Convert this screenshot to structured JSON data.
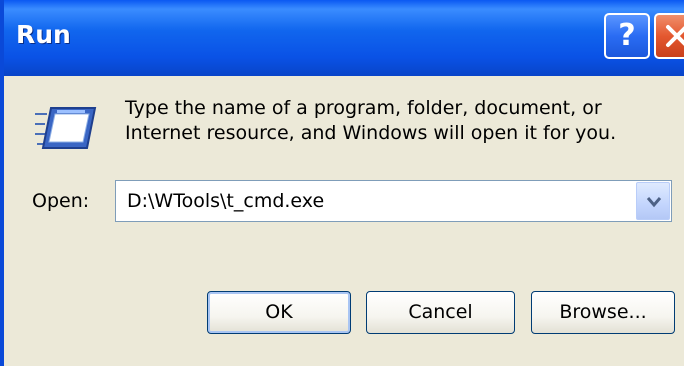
{
  "window": {
    "title": "Run",
    "help_glyph": "?",
    "close_icon": "close-icon"
  },
  "content": {
    "icon": "run-icon",
    "description": "Type the name of a program, folder, document, or Internet resource, and Windows will open it for you.",
    "open_label": "Open:",
    "open_value": "D:\\WTools\\t_cmd.exe",
    "dropdown_icon": "chevron-down-icon"
  },
  "buttons": {
    "ok": "OK",
    "cancel": "Cancel",
    "browse": "Browse..."
  },
  "colors": {
    "titlebar": "#0a58f2",
    "dialog_bg": "#ece9d8",
    "close_button": "#e4582f",
    "help_button": "#2a6cf3"
  }
}
